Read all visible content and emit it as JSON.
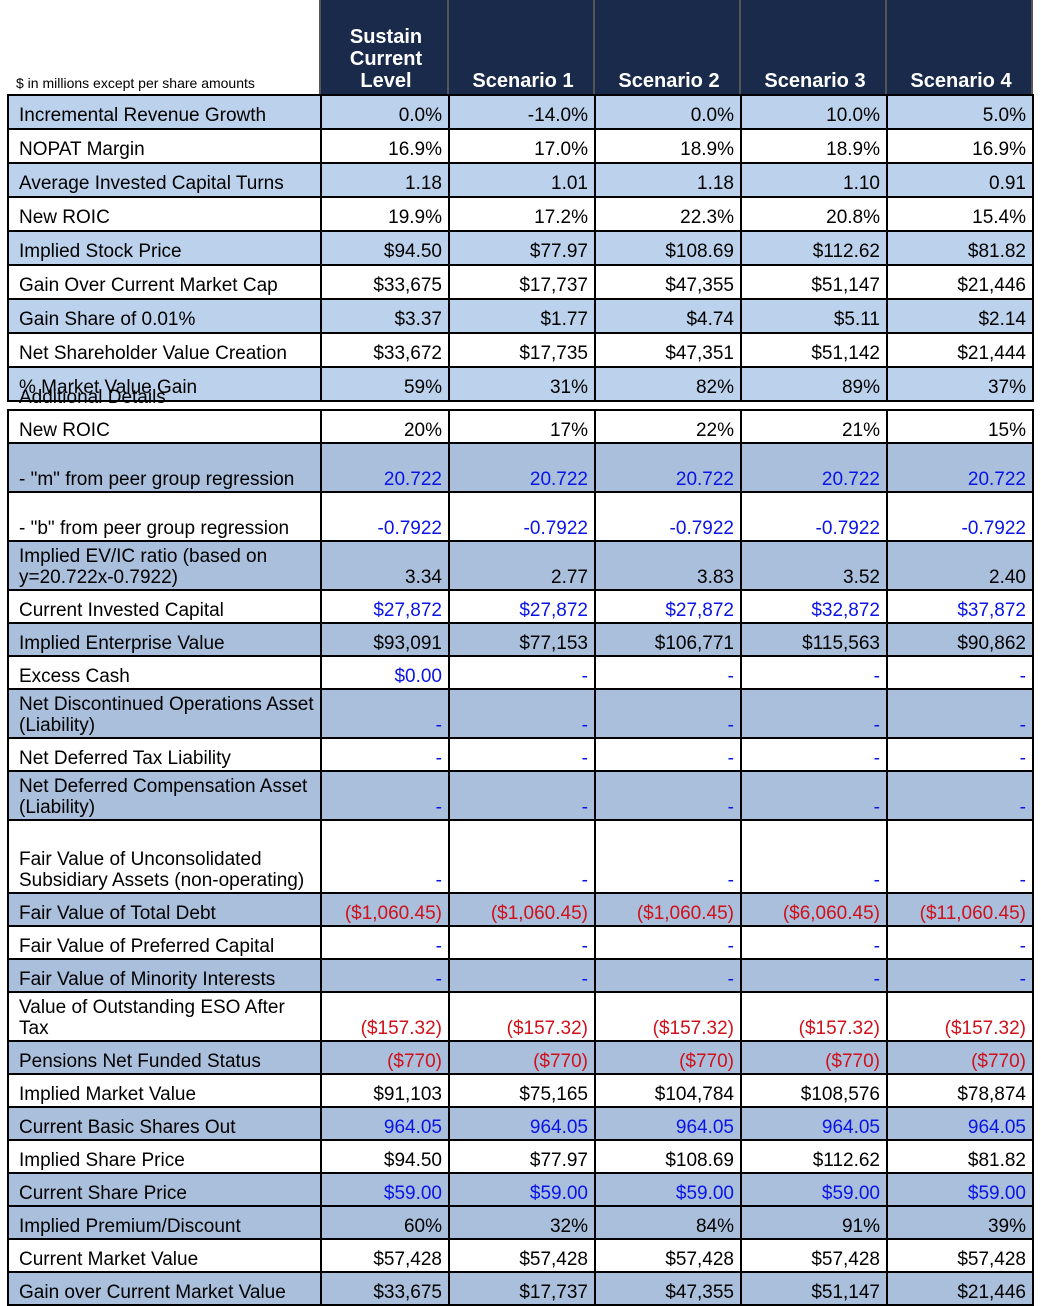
{
  "units_note": "$ in millions except per share amounts",
  "columns": [
    "Sustain Current Level",
    "Scenario 1",
    "Scenario 2",
    "Scenario 3",
    "Scenario 4"
  ],
  "summary_rows": [
    {
      "label": "Incremental Revenue Growth",
      "values": [
        "0.0%",
        "-14.0%",
        "0.0%",
        "10.0%",
        "5.0%"
      ]
    },
    {
      "label": "NOPAT Margin",
      "values": [
        "16.9%",
        "17.0%",
        "18.9%",
        "18.9%",
        "16.9%"
      ]
    },
    {
      "label": "Average Invested Capital Turns",
      "values": [
        "1.18",
        "1.01",
        "1.18",
        "1.10",
        "0.91"
      ]
    },
    {
      "label": "New ROIC",
      "values": [
        "19.9%",
        "17.2%",
        "22.3%",
        "20.8%",
        "15.4%"
      ]
    },
    {
      "label": "Implied Stock Price",
      "values": [
        "$94.50",
        "$77.97",
        "$108.69",
        "$112.62",
        "$81.82"
      ]
    },
    {
      "label": "Gain Over Current Market Cap",
      "values": [
        "$33,675",
        "$17,737",
        "$47,355",
        "$51,147",
        "$21,446"
      ]
    },
    {
      "label": "Gain Share of 0.01%",
      "values": [
        "$3.37",
        "$1.77",
        "$4.74",
        "$5.11",
        "$2.14"
      ]
    },
    {
      "label": "Net Shareholder Value Creation",
      "values": [
        "$33,672",
        "$17,735",
        "$47,351",
        "$51,142",
        "$21,444"
      ]
    },
    {
      "label": "% Market Value Gain",
      "values": [
        "59%",
        "31%",
        "82%",
        "89%",
        "37%"
      ]
    }
  ],
  "additional_details_label": "Additional Details",
  "detail_rows": [
    {
      "label": "New ROIC",
      "values": [
        "20%",
        "17%",
        "22%",
        "21%",
        "15%"
      ],
      "color": "black"
    },
    {
      "label": " - \"m\" from peer group regression",
      "values": [
        "20.722",
        "20.722",
        "20.722",
        "20.722",
        "20.722"
      ],
      "color": "blue"
    },
    {
      "label": " - \"b\" from peer group regression",
      "values": [
        "-0.7922",
        "-0.7922",
        "-0.7922",
        "-0.7922",
        "-0.7922"
      ],
      "color": "blue"
    },
    {
      "label": "Implied EV/IC ratio (based on y=20.722x-0.7922)",
      "values": [
        "3.34",
        "2.77",
        "3.83",
        "3.52",
        "2.40"
      ],
      "color": "black"
    },
    {
      "label": "Current Invested Capital",
      "values": [
        "$27,872",
        "$27,872",
        "$27,872",
        "$32,872",
        "$37,872"
      ],
      "color": "blue"
    },
    {
      "label": "Implied Enterprise Value",
      "values": [
        "$93,091",
        "$77,153",
        "$106,771",
        "$115,563",
        "$90,862"
      ],
      "color": "black"
    },
    {
      "label": "Excess Cash",
      "values": [
        "$0.00",
        "-",
        "-",
        "-",
        "-"
      ],
      "color": "blue"
    },
    {
      "label": "Net Discontinued Operations Asset (Liability)",
      "values": [
        "-",
        "-",
        "-",
        "-",
        "-"
      ],
      "color": "blue"
    },
    {
      "label": "Net Deferred Tax Liability",
      "values": [
        "-",
        "-",
        "-",
        "-",
        "-"
      ],
      "color": "blue"
    },
    {
      "label": "Net Deferred Compensation Asset (Liability)",
      "values": [
        "-",
        "-",
        "-",
        "-",
        "-"
      ],
      "color": "blue"
    },
    {
      "label": "Fair Value of Unconsolidated Subsidiary Assets (non-operating)",
      "values": [
        "-",
        "-",
        "-",
        "-",
        "-"
      ],
      "color": "blue"
    },
    {
      "label": "Fair Value of Total Debt",
      "values": [
        "($1,060.45)",
        "($1,060.45)",
        "($1,060.45)",
        "($6,060.45)",
        "($11,060.45)"
      ],
      "color": "red"
    },
    {
      "label": "Fair Value of Preferred Capital",
      "values": [
        "-",
        "-",
        "-",
        "-",
        "-"
      ],
      "color": "blue"
    },
    {
      "label": "Fair Value of Minority Interests",
      "values": [
        "-",
        "-",
        "-",
        "-",
        "-"
      ],
      "color": "blue"
    },
    {
      "label": "Value of Outstanding ESO After Tax",
      "values": [
        "($157.32)",
        "($157.32)",
        "($157.32)",
        "($157.32)",
        "($157.32)"
      ],
      "color": "red"
    },
    {
      "label": "Pensions Net Funded Status",
      "values": [
        "($770)",
        "($770)",
        "($770)",
        "($770)",
        "($770)"
      ],
      "color": "red"
    },
    {
      "label": "Implied Market Value",
      "values": [
        "$91,103",
        "$75,165",
        "$104,784",
        "$108,576",
        "$78,874"
      ],
      "color": "black"
    },
    {
      "label": "Current Basic Shares Out",
      "values": [
        "964.05",
        "964.05",
        "964.05",
        "964.05",
        "964.05"
      ],
      "color": "blue"
    },
    {
      "label": "Implied Share Price",
      "values": [
        "$94.50",
        "$77.97",
        "$108.69",
        "$112.62",
        "$81.82"
      ],
      "color": "black"
    },
    {
      "label": "Current Share Price",
      "values": [
        "$59.00",
        "$59.00",
        "$59.00",
        "$59.00",
        "$59.00"
      ],
      "color": "blue"
    },
    {
      "label": "Implied Premium/Discount",
      "values": [
        "60%",
        "32%",
        "84%",
        "91%",
        "39%"
      ],
      "color": "black"
    },
    {
      "label": "Current Market Value",
      "values": [
        "$57,428",
        "$57,428",
        "$57,428",
        "$57,428",
        "$57,428"
      ],
      "color": "black"
    },
    {
      "label": "Gain over Current Market Value",
      "values": [
        "$33,675",
        "$17,737",
        "$47,355",
        "$51,147",
        "$21,446"
      ],
      "color": "black"
    }
  ],
  "colors": {
    "header_bg": "#1a2a4a",
    "shade_top": "#bcd2ec",
    "shade_bottom": "#a9bfdc",
    "input_blue": "#0a14e6",
    "negative_red": "#d0101a"
  }
}
